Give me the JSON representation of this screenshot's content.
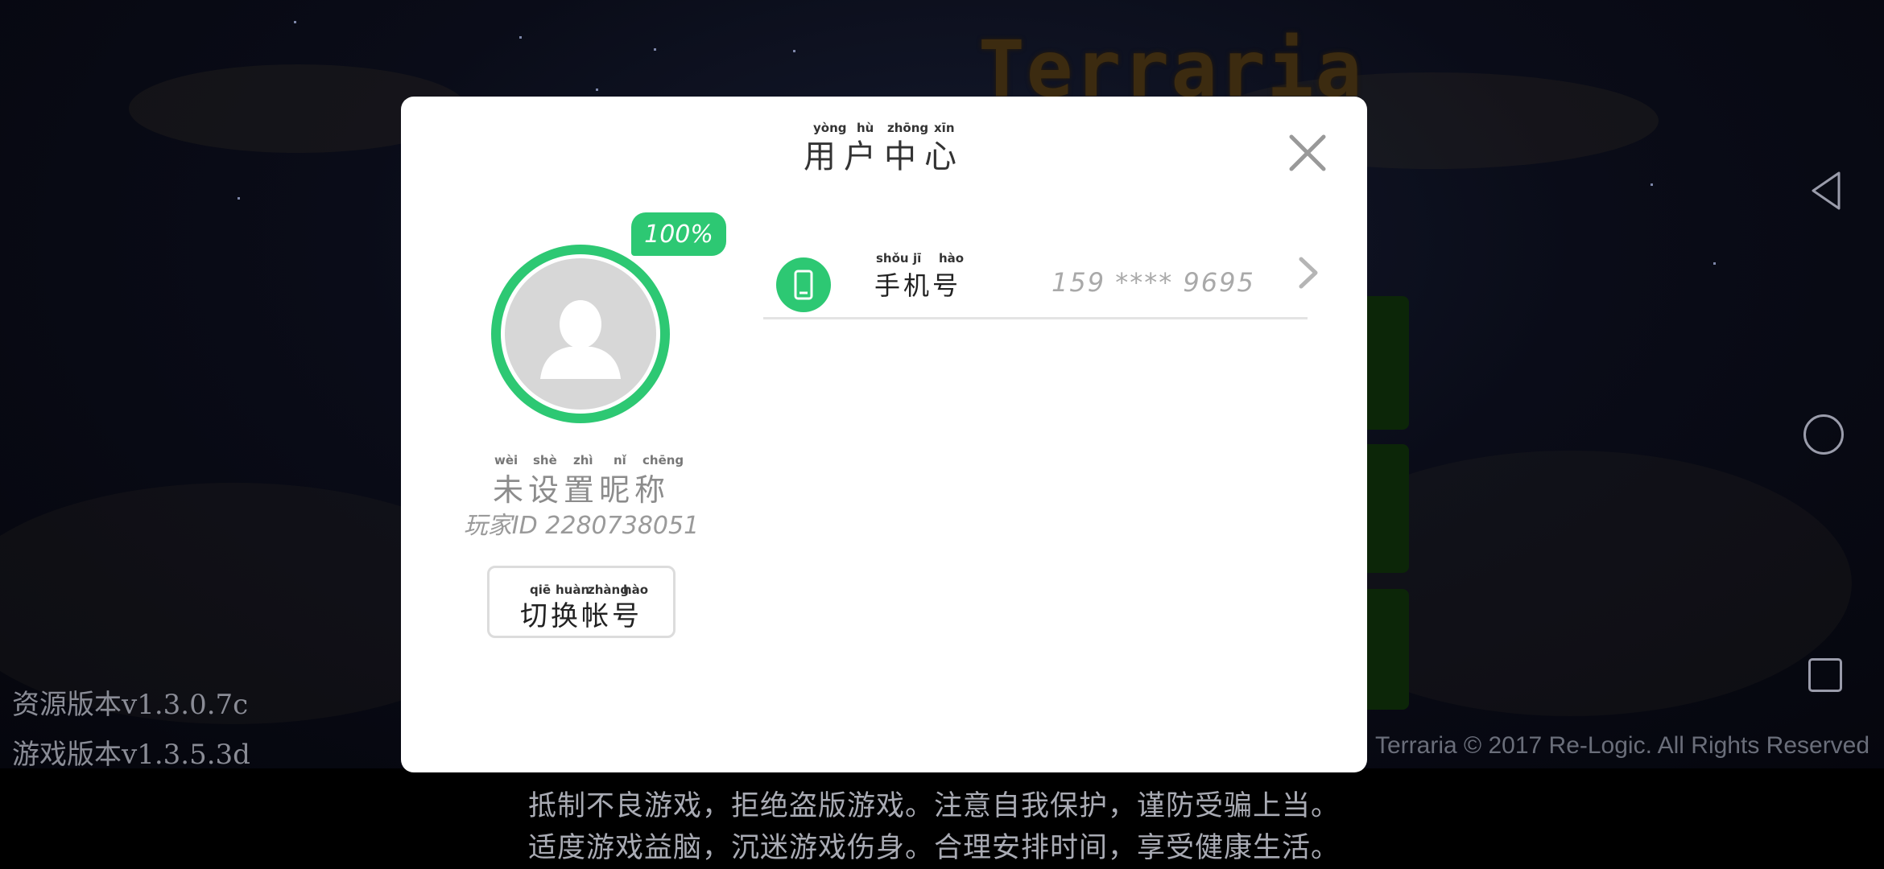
{
  "background": {
    "logo_text": "Terraria",
    "resource_version": "资源版本v1.3.0.7c",
    "game_version": "游戏版本v1.3.5.3d",
    "copyright": "Terraria © 2017 Re-Logic. All Rights Reserved"
  },
  "advisory": {
    "line1": "抵制不良游戏，拒绝盗版游戏。注意自我保护，谨防受骗上当。",
    "line2": "适度游戏益脑，沉迷游戏伤身。合理安排时间，享受健康生活。"
  },
  "dialog": {
    "title": "用户中心",
    "title_pinyin": [
      "yòng",
      "hù",
      "zhōng",
      "xīn"
    ],
    "profile_completion": "100%",
    "nickname": "未设置昵称",
    "nickname_pinyin": [
      "wèi",
      "shè",
      "zhì",
      "nǐ",
      "chēng"
    ],
    "player_id": "玩家ID 2280738051",
    "switch_account_label": "切换帐号",
    "switch_account_pinyin": [
      "qiē",
      "huàn",
      "zhàng",
      "hào"
    ],
    "phone": {
      "label": "手机号",
      "label_pinyin": [
        "shǒu",
        "jī",
        "hào"
      ],
      "value": "159 **** 9695"
    }
  },
  "colors": {
    "accent": "#2dc873",
    "dialog_bg": "#ffffff"
  },
  "icons": {
    "close": "close-icon",
    "avatar": "user-silhouette-icon",
    "phone": "phone-icon",
    "chevron": "chevron-right-icon"
  }
}
